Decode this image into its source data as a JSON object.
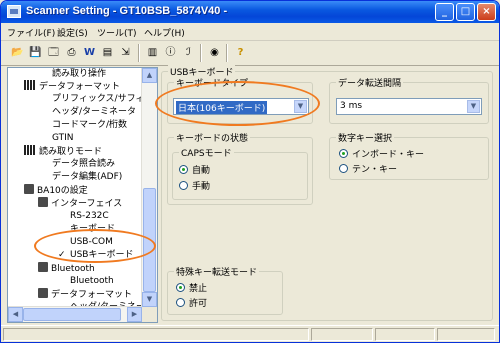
{
  "window": {
    "title": "Scanner Setting - GT10BSB_5874V40 -",
    "buttons": {
      "minimize": "_",
      "maximize": "□",
      "close": "×"
    }
  },
  "menu": [
    "ファイル(F)",
    "設定(S)",
    "ツール(T)",
    "ヘルプ(H)"
  ],
  "toolbar": {
    "icons": [
      "open-folder-icon",
      "save-icon",
      "print-preview-icon",
      "print-icon",
      "word-icon",
      "export-icon",
      "import-icon",
      "config-icon",
      "info-icon",
      "manual-icon",
      "view-icon",
      "help-icon"
    ],
    "glyphs": [
      "📂",
      "💾",
      "🗔",
      "⎙",
      "W",
      "▤",
      "⇲",
      "▥",
      "ⓘ",
      "ℐ",
      "◉",
      "?"
    ]
  },
  "tree": {
    "items": [
      {
        "label": "読み取り操作"
      },
      {
        "label": "データフォーマット"
      },
      {
        "label": "プリフィックス/サフィッ"
      },
      {
        "label": "ヘッダ/ターミネータ"
      },
      {
        "label": "コードマーク/桁数"
      },
      {
        "label": "GTIN"
      },
      {
        "label": "読み取りモード"
      },
      {
        "label": "データ照合読み"
      },
      {
        "label": "データ編集(ADF)"
      },
      {
        "label": "BA10の設定"
      },
      {
        "label": "インターフェイス"
      },
      {
        "label": "RS-232C"
      },
      {
        "label": "キーボード"
      },
      {
        "label": "USB-COM"
      },
      {
        "label": "USBキーボード",
        "check": "✓"
      },
      {
        "label": "Bluetooth"
      },
      {
        "label": "Bluetooth"
      },
      {
        "label": "データフォーマット"
      },
      {
        "label": "ヘッダ/ターミネー:"
      }
    ]
  },
  "panel": {
    "group_title": "USBキーボード",
    "keyboard_type": {
      "label": "キーボードタイプ",
      "value": "日本(106キーボード)"
    },
    "transfer_interval": {
      "label": "データ転送間隔",
      "value": "3 ms"
    },
    "keyboard_state": {
      "label": "キーボードの状態"
    },
    "caps_mode": {
      "label": "CAPSモード",
      "options": [
        "自動",
        "手動"
      ],
      "selected": "自動"
    },
    "numeric_key": {
      "label": "数字キー選択",
      "options": [
        "インボード・キー",
        "テン・キー"
      ],
      "selected": "インボード・キー"
    },
    "special_key": {
      "label": "特殊キー転送モード",
      "options": [
        "禁止",
        "許可"
      ],
      "selected": "禁止"
    }
  },
  "colors": {
    "highlight": "#f07a20",
    "titlebar": "#0a58e0",
    "selection": "#316ac5"
  }
}
